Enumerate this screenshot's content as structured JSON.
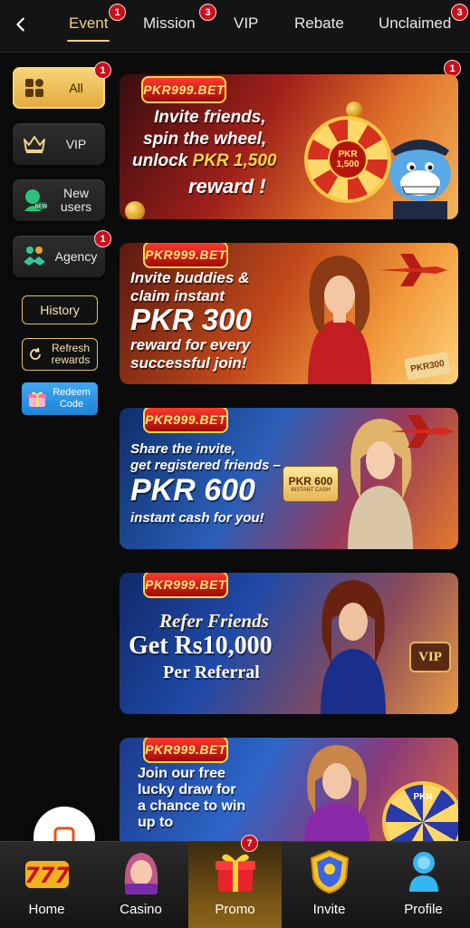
{
  "header": {
    "tabs": [
      {
        "label": "Event",
        "badge": "1",
        "active": true
      },
      {
        "label": "Mission",
        "badge": "3"
      },
      {
        "label": "VIP"
      },
      {
        "label": "Rebate"
      },
      {
        "label": "Unclaimed",
        "badge": "3"
      }
    ]
  },
  "sidebar": {
    "categories": [
      {
        "label": "All",
        "badge": "1",
        "icon": "grid-icon",
        "active": true
      },
      {
        "label": "VIP",
        "icon": "crown-icon"
      },
      {
        "label": "New users",
        "icon": "new-user-icon"
      },
      {
        "label": "Agency",
        "badge": "1",
        "icon": "handshake-icon"
      }
    ],
    "history_label": "History",
    "refresh_label": "Refresh rewards",
    "redeem_label": "Redeem Code"
  },
  "banners_badge": "1",
  "banners": [
    {
      "logo": "PKR999.BET",
      "line1": "Invite friends,",
      "line2": "spin the wheel,",
      "line3a": "unlock ",
      "line3b": "PKR 1,500",
      "line4": "reward !",
      "wheel_center": "PKR 1,500"
    },
    {
      "logo": "PKR999.BET",
      "line1": "Invite buddies &",
      "line2": "claim instant",
      "line3": "PKR 300",
      "line4": "reward for every",
      "line5": "successful join!",
      "tag": "PKR300"
    },
    {
      "logo": "PKR999.BET",
      "line1": "Share the invite,",
      "line2": "get registered friends –",
      "line3": "PKR 600",
      "line4": "instant cash for you!",
      "card": "PKR 600",
      "card_sub": "INSTANT CASH"
    },
    {
      "logo": "PKR999.BET",
      "line1": "Refer Friends",
      "line2": "Get Rs10,000",
      "line3": "Per Referral",
      "vip": "VIP"
    },
    {
      "logo": "PKR999.BET",
      "line1": "Join our free",
      "line2": "lucky draw for",
      "line3": "a chance to win",
      "line4": "up to",
      "wheel": "PKR"
    }
  ],
  "bottom_nav": {
    "items": [
      {
        "label": "Home",
        "icon": "slot-777-icon"
      },
      {
        "label": "Casino",
        "icon": "casino-girl-icon"
      },
      {
        "label": "Promo",
        "icon": "gift-box-icon",
        "badge": "7",
        "active": true
      },
      {
        "label": "Invite",
        "icon": "shield-invite-icon"
      },
      {
        "label": "Profile",
        "icon": "profile-icon"
      }
    ]
  },
  "colors": {
    "accent": "#f3cf7a",
    "badge": "#c8101c",
    "background": "#0b0b0b"
  }
}
